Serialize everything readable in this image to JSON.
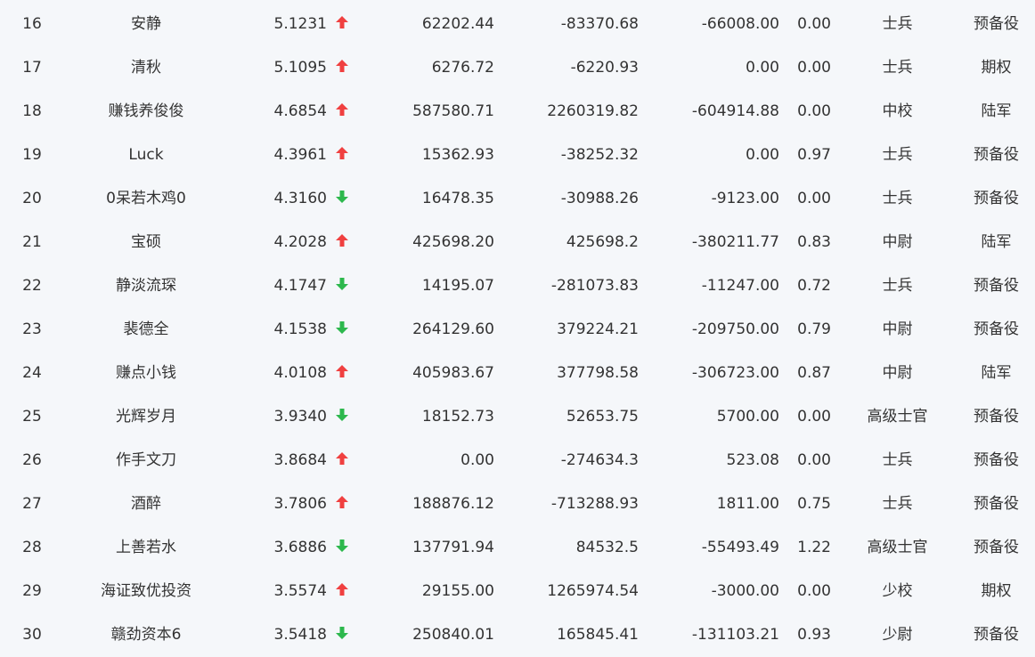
{
  "colors": {
    "up": "#f04040",
    "down": "#2db84d",
    "text": "#333333",
    "background": "#f5f7fa"
  },
  "rows": [
    {
      "rank": "16",
      "name": "安静",
      "score": "5.1231",
      "trend": "up",
      "v1": "62202.44",
      "v2": "-83370.68",
      "v3": "-66008.00",
      "v4": "0.00",
      "level": "士兵",
      "group": "预备役"
    },
    {
      "rank": "17",
      "name": "清秋",
      "score": "5.1095",
      "trend": "up",
      "v1": "6276.72",
      "v2": "-6220.93",
      "v3": "0.00",
      "v4": "0.00",
      "level": "士兵",
      "group": "期权"
    },
    {
      "rank": "18",
      "name": "赚钱养俊俊",
      "score": "4.6854",
      "trend": "up",
      "v1": "587580.71",
      "v2": "2260319.82",
      "v3": "-604914.88",
      "v4": "0.00",
      "level": "中校",
      "group": "陆军"
    },
    {
      "rank": "19",
      "name": "Luck",
      "score": "4.3961",
      "trend": "up",
      "v1": "15362.93",
      "v2": "-38252.32",
      "v3": "0.00",
      "v4": "0.97",
      "level": "士兵",
      "group": "预备役"
    },
    {
      "rank": "20",
      "name": "0呆若木鸡0",
      "score": "4.3160",
      "trend": "down",
      "v1": "16478.35",
      "v2": "-30988.26",
      "v3": "-9123.00",
      "v4": "0.00",
      "level": "士兵",
      "group": "预备役"
    },
    {
      "rank": "21",
      "name": "宝硕",
      "score": "4.2028",
      "trend": "up",
      "v1": "425698.20",
      "v2": "425698.2",
      "v3": "-380211.77",
      "v4": "0.83",
      "level": "中尉",
      "group": "陆军"
    },
    {
      "rank": "22",
      "name": "静淡流琛",
      "score": "4.1747",
      "trend": "down",
      "v1": "14195.07",
      "v2": "-281073.83",
      "v3": "-11247.00",
      "v4": "0.72",
      "level": "士兵",
      "group": "预备役"
    },
    {
      "rank": "23",
      "name": "裴德全",
      "score": "4.1538",
      "trend": "down",
      "v1": "264129.60",
      "v2": "379224.21",
      "v3": "-209750.00",
      "v4": "0.79",
      "level": "中尉",
      "group": "预备役"
    },
    {
      "rank": "24",
      "name": "赚点小钱",
      "score": "4.0108",
      "trend": "up",
      "v1": "405983.67",
      "v2": "377798.58",
      "v3": "-306723.00",
      "v4": "0.87",
      "level": "中尉",
      "group": "陆军"
    },
    {
      "rank": "25",
      "name": "光辉岁月",
      "score": "3.9340",
      "trend": "down",
      "v1": "18152.73",
      "v2": "52653.75",
      "v3": "5700.00",
      "v4": "0.00",
      "level": "高级士官",
      "group": "预备役"
    },
    {
      "rank": "26",
      "name": "作手文刀",
      "score": "3.8684",
      "trend": "up",
      "v1": "0.00",
      "v2": "-274634.3",
      "v3": "523.08",
      "v4": "0.00",
      "level": "士兵",
      "group": "预备役"
    },
    {
      "rank": "27",
      "name": "酒醉",
      "score": "3.7806",
      "trend": "up",
      "v1": "188876.12",
      "v2": "-713288.93",
      "v3": "1811.00",
      "v4": "0.75",
      "level": "士兵",
      "group": "预备役"
    },
    {
      "rank": "28",
      "name": "上善若水",
      "score": "3.6886",
      "trend": "down",
      "v1": "137791.94",
      "v2": "84532.5",
      "v3": "-55493.49",
      "v4": "1.22",
      "level": "高级士官",
      "group": "预备役"
    },
    {
      "rank": "29",
      "name": "海证致优投资",
      "score": "3.5574",
      "trend": "up",
      "v1": "29155.00",
      "v2": "1265974.54",
      "v3": "-3000.00",
      "v4": "0.00",
      "level": "少校",
      "group": "期权"
    },
    {
      "rank": "30",
      "name": "赣劲资本6",
      "score": "3.5418",
      "trend": "down",
      "v1": "250840.01",
      "v2": "165845.41",
      "v3": "-131103.21",
      "v4": "0.93",
      "level": "少尉",
      "group": "预备役"
    }
  ]
}
